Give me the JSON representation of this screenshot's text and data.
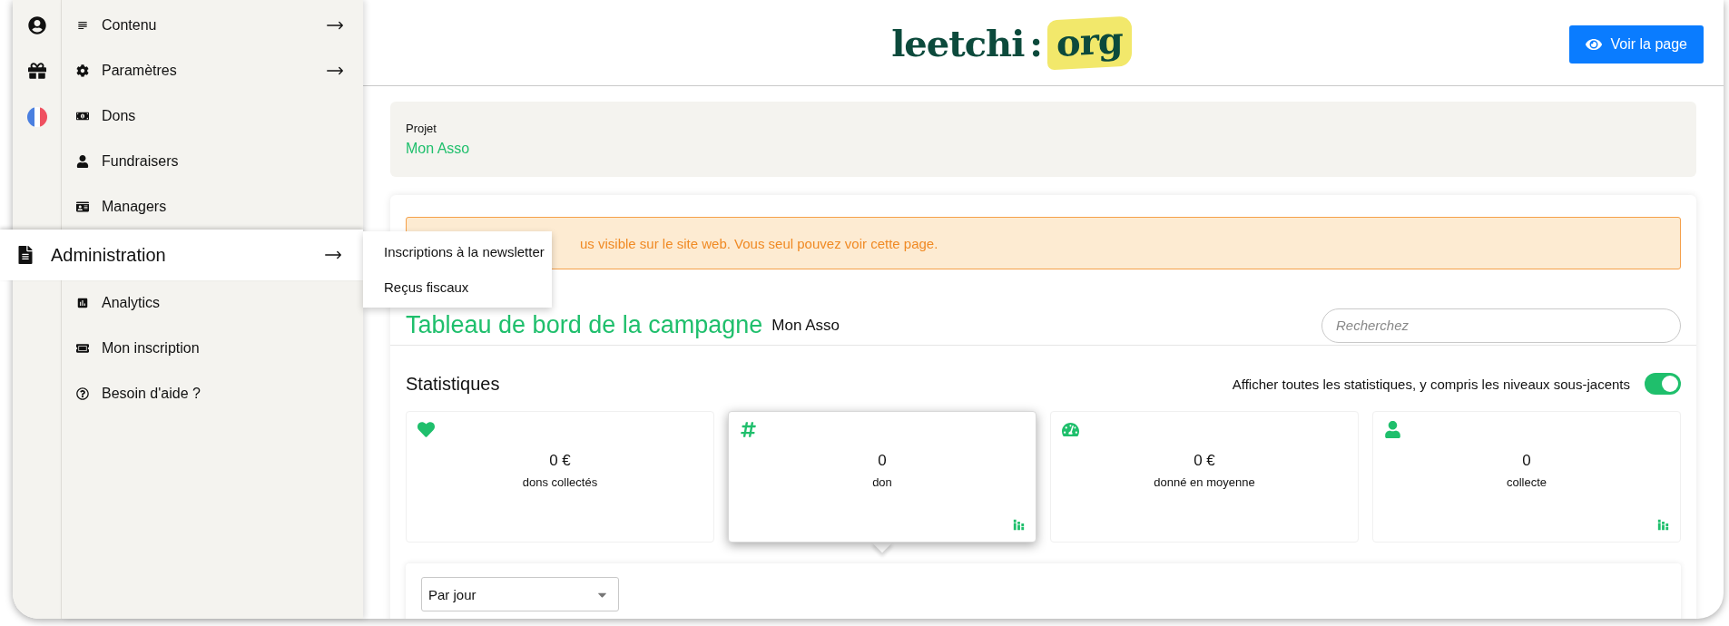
{
  "menu": {
    "items": [
      {
        "label": "Contenu",
        "submenu": true,
        "selected": false
      },
      {
        "label": "Paramètres",
        "submenu": true,
        "selected": false
      },
      {
        "label": "Dons",
        "submenu": false,
        "selected": false
      },
      {
        "label": "Fundraisers",
        "submenu": false,
        "selected": false
      },
      {
        "label": "Managers",
        "submenu": false,
        "selected": false
      },
      {
        "label": "Administration",
        "submenu": true,
        "selected": true
      },
      {
        "label": "Analytics",
        "submenu": false,
        "selected": false
      },
      {
        "label": "Mon inscription",
        "submenu": false,
        "selected": false
      },
      {
        "label": "Besoin d'aide ?",
        "submenu": false,
        "selected": false
      }
    ],
    "submenu": [
      "Inscriptions à la newsletter",
      "Reçus fiscaux"
    ]
  },
  "header": {
    "logo": {
      "left": "leetchi",
      "separator": ":",
      "right": "org"
    },
    "button": "Voir la page"
  },
  "project": {
    "label": "Projet",
    "value": "Mon Asso"
  },
  "banner": "us visible sur le site web. Vous seul pouvez voir cette page.",
  "dashboard": {
    "title": "Tableau de bord de la campagne",
    "subtitle": "Mon Asso",
    "search": {
      "placeholder": "Recherchez"
    }
  },
  "statistics": {
    "title": "Statistiques",
    "toggle": {
      "label": "Afficher toutes les statistiques, y compris les niveaux sous-jacents",
      "on": true
    },
    "cards": [
      {
        "value": "0 €",
        "label": "dons collectés",
        "selected": false,
        "chart": false
      },
      {
        "value": "0",
        "label": "don",
        "selected": true,
        "chart": true
      },
      {
        "value": "0 €",
        "label": "donné en moyenne",
        "selected": false,
        "chart": false
      },
      {
        "value": "0",
        "label": "collecte",
        "selected": false,
        "chart": true
      }
    ],
    "period": {
      "value": "Par jour"
    }
  }
}
